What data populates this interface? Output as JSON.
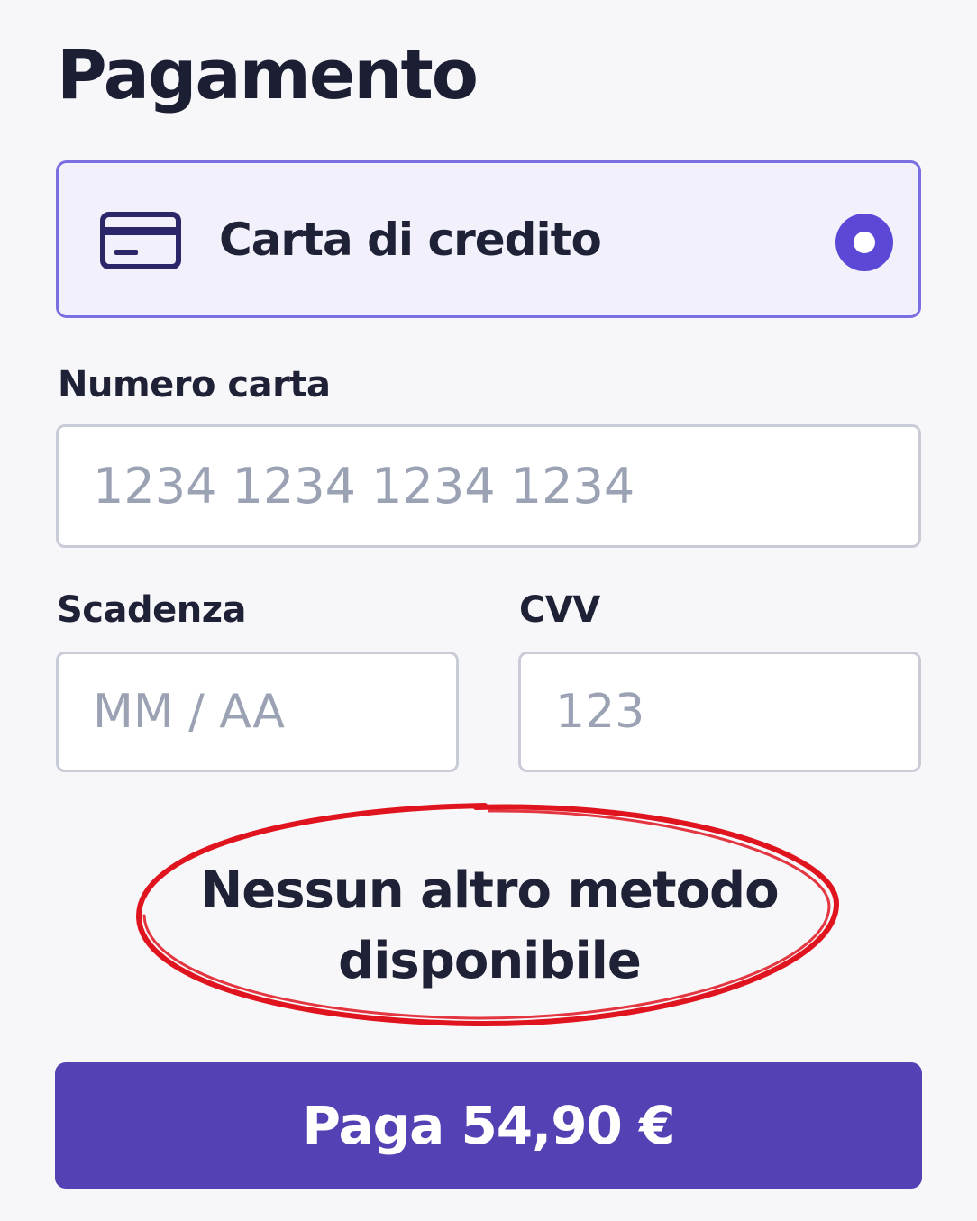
{
  "page": {
    "title": "Pagamento"
  },
  "payment_method": {
    "label": "Carta di credito",
    "icon": "credit-card-icon",
    "selected": true,
    "accent_color": "#5b48d6"
  },
  "form": {
    "card_number": {
      "label": "Numero carta",
      "placeholder": "1234 1234 1234 1234",
      "value": ""
    },
    "expiry": {
      "label": "Scadenza",
      "placeholder": "MM / AA",
      "value": ""
    },
    "cvv": {
      "label": "CVV",
      "placeholder": "123",
      "value": ""
    }
  },
  "annotation": {
    "line1": "Nessun altro metodo",
    "line2": "disponibile",
    "color": "#e0141e"
  },
  "pay_button": {
    "label": "Paga 54,90 €",
    "color": "#5441b3"
  }
}
